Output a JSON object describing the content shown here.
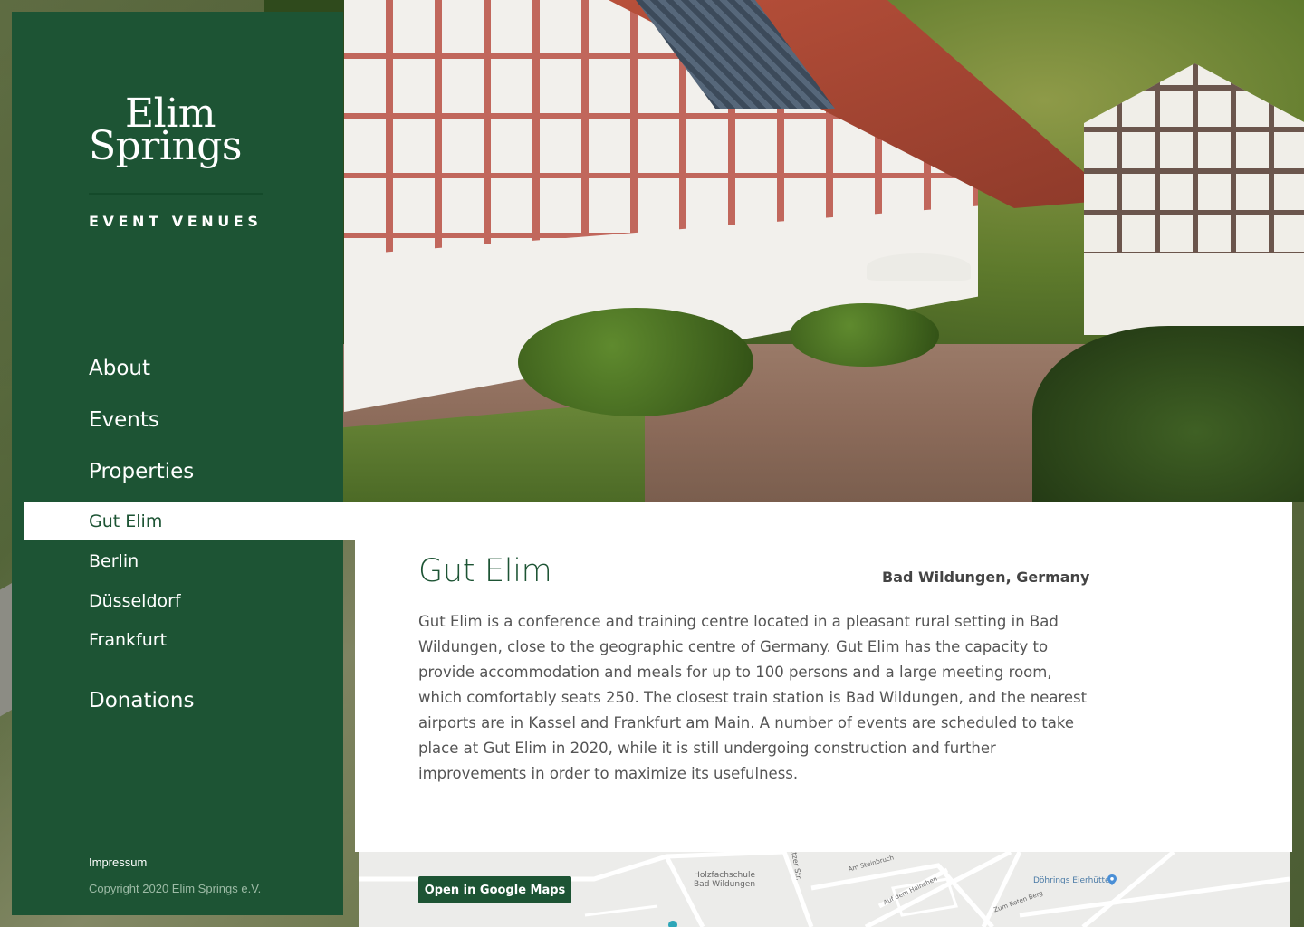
{
  "brand": {
    "logo_line1": "Elim",
    "logo_line2": "Springs",
    "tagline": "EVENT VENUES",
    "color": "#1d5434"
  },
  "nav": {
    "about": "About",
    "events": "Events",
    "properties": "Properties",
    "property_items": {
      "gut_elim": "Gut Elim",
      "berlin": "Berlin",
      "duesseldorf": "Düsseldorf",
      "frankfurt": "Frankfurt"
    },
    "active_item": "Gut Elim",
    "donations": "Donations"
  },
  "footer": {
    "impressum": "Impressum",
    "copyright": "Copyright 2020 Elim Springs e.V."
  },
  "venue": {
    "title": "Gut Elim",
    "location": "Bad Wildungen, Germany",
    "description": "Gut Elim is a conference and training centre located in a pleasant rural setting in Bad Wildungen, close to the geographic centre of Germany. Gut Elim has the capacity to provide accommodation and meals for up to 100 persons and a large meeting room, which comfortably seats 250. The closest train station is Bad Wildungen, and the nearest airports are in Kassel and Frankfurt am Main. A number of events are scheduled to take place at Gut Elim in 2020, while it is still undergoing construction and further improvements in order to maximize its usefulness."
  },
  "map": {
    "button_label": "Open in Google Maps",
    "labels": {
      "school_line1": "Holzfachschule",
      "school_line2": "Bad Wildungen",
      "street1": "Am Steinbruch",
      "street2": "Auf dem Hainchen",
      "street3": "Zum Roten Berg",
      "street4": "itzer Str.",
      "poi": "Döhrings Eierhütte"
    }
  }
}
